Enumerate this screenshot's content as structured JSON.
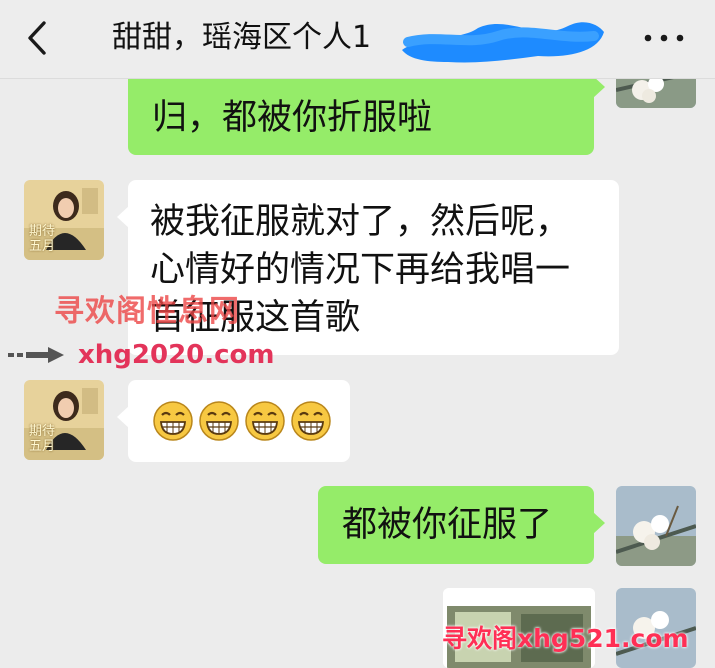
{
  "header": {
    "back_icon": "chevron-left-icon",
    "title": "甜甜，瑶海区个人1",
    "more_icon": "more-dots-icon"
  },
  "messages": [
    {
      "side": "out",
      "lines": [
        "归，都被你折服啦"
      ]
    },
    {
      "side": "in",
      "avatar_caption": "期待\n五月",
      "lines": [
        "被我征服就对了，然后呢，",
        "心情好的情况下再给我唱一",
        "首征服这首歌"
      ]
    },
    {
      "side": "in",
      "avatar_caption": "期待\n五月",
      "emojis": [
        "grin-emoji",
        "grin-emoji",
        "grin-emoji",
        "grin-emoji"
      ]
    },
    {
      "side": "out",
      "lines": [
        "都被你征服了"
      ]
    },
    {
      "side": "out",
      "type": "image"
    }
  ],
  "watermarks": {
    "top": "寻欢阁性息网",
    "url": "xhg2020.com",
    "bottom": "寻欢阁xhg521.com"
  },
  "colors": {
    "background": "#ececec",
    "outgoing_bubble": "#95ec69",
    "incoming_bubble": "#ffffff",
    "redaction": "#1e8bff"
  }
}
